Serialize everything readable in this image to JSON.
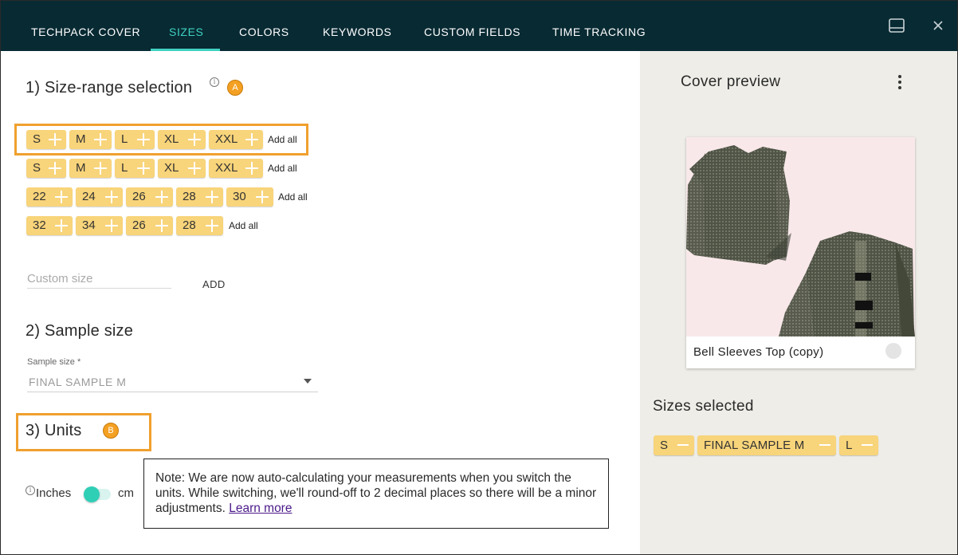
{
  "tabs": [
    {
      "label": "TECHPACK COVER",
      "active": false
    },
    {
      "label": "SIZES",
      "active": true
    },
    {
      "label": "COLORS",
      "active": false
    },
    {
      "label": "KEYWORDS",
      "active": false
    },
    {
      "label": "CUSTOM FIELDS",
      "active": false
    },
    {
      "label": "TIME TRACKING",
      "active": false
    }
  ],
  "toolbar_icons": [
    "panel-icon",
    "close-icon"
  ],
  "section1": {
    "title": "1) Size-range selection",
    "info_glyph": "i",
    "badge": "A",
    "ranges": [
      {
        "sizes": [
          "S",
          "M",
          "L",
          "XL",
          "XXL"
        ],
        "add_all": "Add all"
      },
      {
        "sizes": [
          "S",
          "M",
          "L",
          "XL",
          "XXL"
        ],
        "add_all": "Add all"
      },
      {
        "sizes": [
          "22",
          "24",
          "26",
          "28",
          "30"
        ],
        "add_all": "Add all"
      },
      {
        "sizes": [
          "32",
          "34",
          "26",
          "28"
        ],
        "add_all": "Add all"
      }
    ],
    "custom_size": {
      "placeholder": "Custom size",
      "value": ""
    },
    "add_label": "ADD"
  },
  "section2": {
    "title": "2) Sample size",
    "field_label": "Sample size *",
    "selected": "FINAL SAMPLE M"
  },
  "section3": {
    "title": "3) Units",
    "badge": "B",
    "info_glyph": "i",
    "unit_left": "Inches",
    "unit_right": "cm",
    "toggle_on": false
  },
  "note": {
    "text": "Note: We are now auto-calculating your measurements when you switch the units. While switching, we'll round-off to 2 decimal places so there will be a minor adjustments.",
    "link": "Learn more"
  },
  "preview": {
    "title": "Cover preview",
    "product_name": "Bell Sleeves Top (copy)"
  },
  "sizes_selected": {
    "title": "Sizes selected",
    "chips": [
      "S",
      "FINAL SAMPLE M",
      "L"
    ]
  },
  "colors": {
    "nav_bg": "#082a33",
    "accent": "#3fd1c1",
    "chip": "#f8d47a",
    "badge": "#f4a022",
    "highlight": "#f0a02e",
    "panel_bg": "#eeede7"
  }
}
